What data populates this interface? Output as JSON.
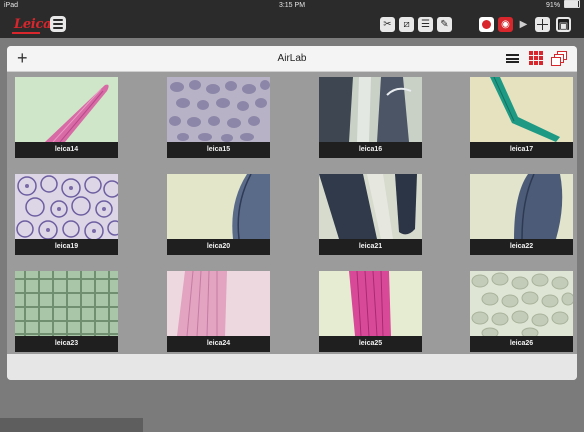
{
  "status_bar": {
    "device": "iPad",
    "time": "3:15 PM",
    "battery": "91%"
  },
  "toolbar": {
    "logo_text": "Leica",
    "brand_color": "#d8262c",
    "icons": [
      "scissors-icon",
      "ruler-icon",
      "sliders-icon",
      "edit-icon",
      "record-icon",
      "camera-icon",
      "video-icon",
      "split-view-icon",
      "gallery-icon"
    ]
  },
  "panel": {
    "title": "AirLab",
    "add_label": "+"
  },
  "thumbnails": [
    {
      "label": "leica14"
    },
    {
      "label": "leica15"
    },
    {
      "label": "leica16"
    },
    {
      "label": "leica17"
    },
    {
      "label": "leica19"
    },
    {
      "label": "leica20"
    },
    {
      "label": "leica21"
    },
    {
      "label": "leica22"
    },
    {
      "label": "leica23"
    },
    {
      "label": "leica24"
    },
    {
      "label": "leica25"
    },
    {
      "label": "leica26"
    }
  ]
}
